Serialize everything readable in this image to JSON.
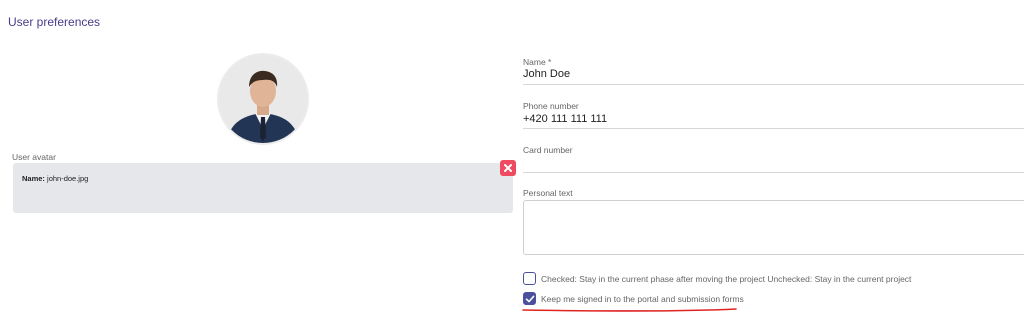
{
  "page": {
    "title": "User preferences"
  },
  "avatar": {
    "label": "User avatar",
    "file": {
      "name_label": "Name:",
      "name_value": "john-doe.jpg"
    },
    "remove_icon": "close-icon"
  },
  "form": {
    "name": {
      "label": "Name *",
      "value": "John Doe"
    },
    "phone": {
      "label": "Phone number",
      "value": "+420 111 111 111"
    },
    "card": {
      "label": "Card number",
      "value": ""
    },
    "personal_text": {
      "label": "Personal text",
      "value": ""
    },
    "stay_in_phase": {
      "label": "Checked: Stay in the current phase after moving the project Unchecked: Stay in the current project",
      "checked": false
    },
    "keep_signed_in": {
      "label": "Keep me signed in to the portal and submission forms",
      "checked": true
    }
  },
  "colors": {
    "accent": "#4c4f9c",
    "danger": "#ef4a5f",
    "highlight_underline": "#e02424"
  }
}
